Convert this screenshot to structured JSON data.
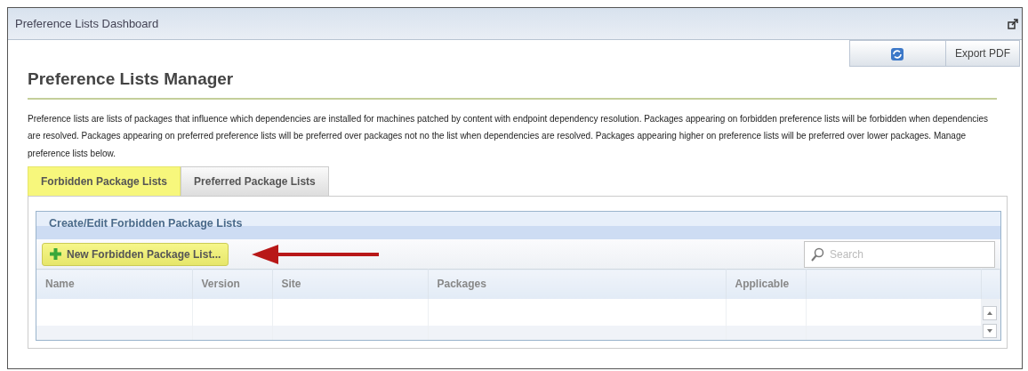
{
  "window": {
    "title": "Preference Lists Dashboard"
  },
  "toolbar": {
    "export_label": "Export PDF"
  },
  "heading": "Preference Lists Manager",
  "description": "Preference lists are lists of packages that influence which dependencies are installed for machines patched by content with endpoint dependency resolution. Packages appearing on forbidden preference lists will be forbidden when dependencies are resolved. Packages appearing on preferred preference lists will be preferred over packages not no the list when dependencies are resolved. Packages appearing higher on preference lists will be preferred over lower packages. Manage preference lists below.",
  "tabs": [
    {
      "label": "Forbidden Package Lists",
      "selected": true
    },
    {
      "label": "Preferred Package Lists",
      "selected": false
    }
  ],
  "panel": {
    "title": "Create/Edit Forbidden Package Lists",
    "new_button": "New Forbidden Package List...",
    "search": {
      "placeholder": "Search"
    },
    "table": {
      "columns": [
        "Name",
        "Version",
        "Site",
        "Packages",
        "Applicable"
      ]
    }
  }
}
